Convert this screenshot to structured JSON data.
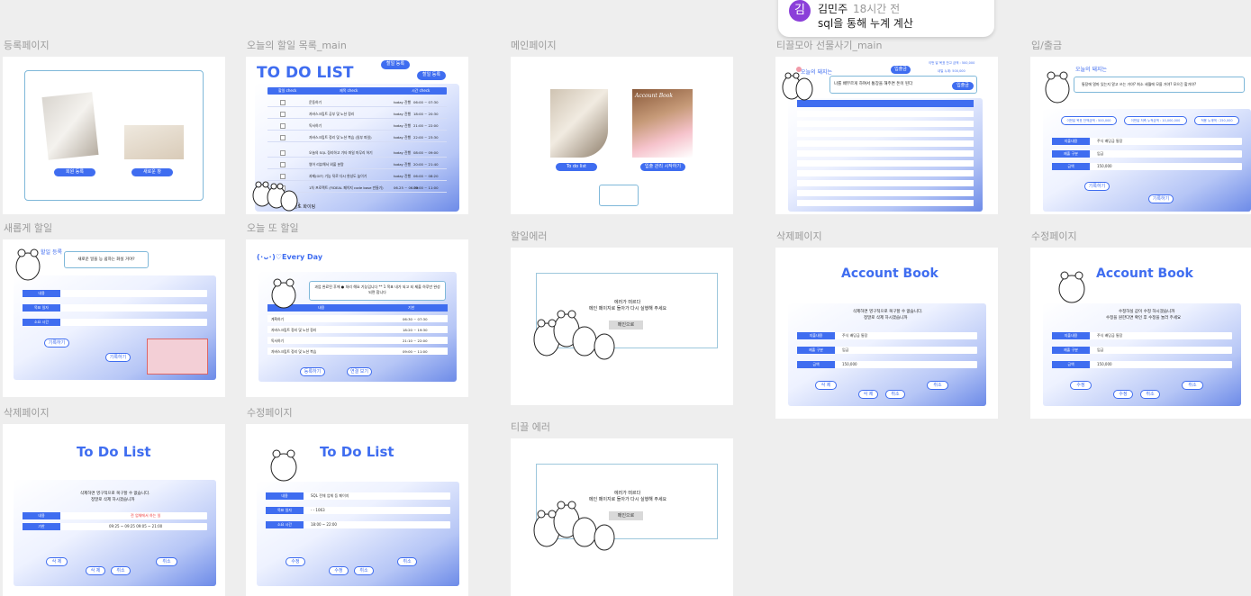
{
  "comment": {
    "avatar_initial": "김",
    "author": "김민주",
    "time": "18시간 전",
    "text": "sql을 통해 누계 계산"
  },
  "frames": {
    "register": {
      "label": "등록페이지",
      "btn_left": "회원 등록",
      "btn_right": "새로운 창"
    },
    "todo_main": {
      "label": "오늘의 할일 목록_main",
      "title": "TO DO LIST",
      "btn_add": "할일 등록",
      "btn_add2": "할일 등록",
      "cols": [
        "할일 check",
        "제목 check",
        "시간 check"
      ],
      "items": [
        {
          "t": "운동하기",
          "d": "today 진행",
          "time": "06:00 ~ 07:30"
        },
        {
          "t": "자바스크립트 공부 및 노션 정리",
          "d": "today 진행",
          "time": "18:00 ~ 20:30"
        },
        {
          "t": "독서하기",
          "d": "today 진행",
          "time": "21:00 ~ 22:00"
        },
        {
          "t": "자바스크립트 정리 및 노션 복습 (일부 파일)",
          "d": "today 진행",
          "time": "22:00 ~ 23:30"
        },
        {
          "t": "오늘의 SQL 정리하고 기타 파일 마무리 하기",
          "d": "today 진행",
          "time": "08:00 ~ 09:00"
        },
        {
          "t": "영어 리뷰해서 외울 분량",
          "d": "today 진행",
          "time": "20:00 ~ 21:40"
        },
        {
          "t": "과제(GIT) 기능 뒤로 다시 완성도 높이기",
          "d": "today 진행",
          "time": "06:00 ~ 08:20"
        },
        {
          "t": "1차 프로젝트 (FIDEAL 페이지 code base 만들기)",
          "d": "06.25 ~ 06.30",
          "time": "09:00 ~ 11:00"
        }
      ],
      "pager": "1 2 3",
      "footer": "오늘도 화이팅"
    },
    "main_page": {
      "label": "메인페이지",
      "book_title": "Account Book",
      "btn_left": "To do list",
      "btn_right": "입출 관리 시작하기"
    },
    "tikkle_main": {
      "label": "티끌모아 선물사기_main",
      "heading": "오늘의 돼지는",
      "speech": "나를 배부르게 하여서 통장을 해주면 돈이 된다",
      "btn_in": "입출금",
      "btn_out": "입출금",
      "pills": [
        "이번 달 목표 잔고 금액 : 500,000",
        "내일 누계: 500,000"
      ]
    },
    "inout": {
      "label": "입/출금",
      "heading": "오늘의 돼지는",
      "speech": "통장에 얼마 있는지 알고 쓰는 거야? 최소 세월에 모을 거야? 모으긴 할거야?",
      "pill1": "이번달 목표 잔액금액 : 500,000",
      "pill2": "이번달 저축 누적금액 : 10,000,000",
      "pill3": "적용 누계액 : 250,000",
      "row_labels": [
        "지출내용",
        "제출 구분",
        "금액"
      ],
      "row_values": [
        "주식 배당금 통장",
        "입금",
        "150,000"
      ],
      "btn_save": "기록하기",
      "btn_back": "기록하기"
    },
    "new_todo": {
      "label": "새롭게 할일",
      "heading": "할일 등록",
      "speech": "새로운 일을 능 쉽하는 화실 거야?",
      "row_labels": [
        "내용",
        "목표 일자",
        "소요 시간"
      ],
      "btn_save": "기록하기",
      "btn_back": "기록하기"
    },
    "today_todo": {
      "label": "오늘 또 할일",
      "heading": "(･ᴗ･)♡Every Day",
      "speech": "과업 완료된 후에 ● 처리 해요 기능입니다 ** 1 목표 내가 되고 되 제출 하루만 완성되면 합니다",
      "cols": [
        "내용",
        "기한"
      ],
      "items": [
        {
          "t": "계획하기",
          "time": "06:30 ~ 07:30"
        },
        {
          "t": "자바스크립트 정리 및 노션 정리",
          "time": "18:20 ~ 19:30"
        },
        {
          "t": "독서하기",
          "time": "21:10 ~ 22:00"
        },
        {
          "t": "자바스크립트 정리 및 노션 복습",
          "time": "09:00 ~ 11:00"
        }
      ],
      "btn_save": "등록하기",
      "btn_back": "연결 보기"
    },
    "todo_err": {
      "label": "할일에러",
      "msg1": "에러가 떠르다",
      "msg2": "메인 페이지로 돌아가 다시 실행해 주세요",
      "btn": "메인으로"
    },
    "tikkle_err": {
      "label": "티끌 에러",
      "msg1": "에러가 떠르다",
      "msg2": "메인 페이지로 돌아가 다시 실행해 주세요",
      "btn": "메인으로"
    },
    "account_delete": {
      "label": "삭제페이지",
      "title": "Account Book",
      "msg1": "삭제하면 영구적으로 복구할 수 없습니다.",
      "msg2": "정말로 삭제 하시겠습니까",
      "row_labels": [
        "지출내용",
        "제출 구분",
        "금액"
      ],
      "row_values": [
        "주식 배당금 통장",
        "입금",
        "150,000"
      ],
      "btn_a": "삭 제",
      "btn_b": "취소",
      "btn_c": "삭 제",
      "btn_d": "취소"
    },
    "account_edit": {
      "label": "수정페이지",
      "title": "Account Book",
      "msg1": "수정하실 값이 수정 하시겠습니까",
      "msg2": "수정을 원한다면 확인 후 수정을 눌러 주세요",
      "row_labels": [
        "지출내용",
        "제출 구분",
        "금액"
      ],
      "row_values": [
        "주식 배당금 통장",
        "입금",
        "150,000"
      ],
      "btn_a": "수정",
      "btn_b": "취소",
      "btn_c": "수정",
      "btn_d": "취소"
    },
    "todo_delete": {
      "label": "삭제페이지",
      "title": "To Do List",
      "msg1": "삭제하면 영구적으로 복구할 수 없습니다.",
      "msg2": "정말로 삭제 하시겠습니까",
      "row_labels": [
        "내용",
        "기한"
      ],
      "row_values": [
        "전 업체에서 하는 일",
        "09:25 ~ 09:25   09:05 ~ 21:00"
      ],
      "btn_a": "삭 제",
      "btn_b": "취소",
      "btn_c": "삭 제",
      "btn_d": "취소"
    },
    "todo_edit": {
      "label": "수정페이지",
      "title": "To Do List",
      "row_labels": [
        "내용",
        "목표 일자",
        "소요 시간"
      ],
      "row_values": [
        "SQL 전체 업체 등 페이지",
        "- - 1063",
        "18:00 ~ 22:00"
      ],
      "btn_a": "수정",
      "btn_b": "수정",
      "btn_c": "취소",
      "btn_d": "취소"
    }
  },
  "colors": {
    "accent": "#3f6df0",
    "canvas": "#eeeeee",
    "avatar": "#8b3fd9"
  }
}
